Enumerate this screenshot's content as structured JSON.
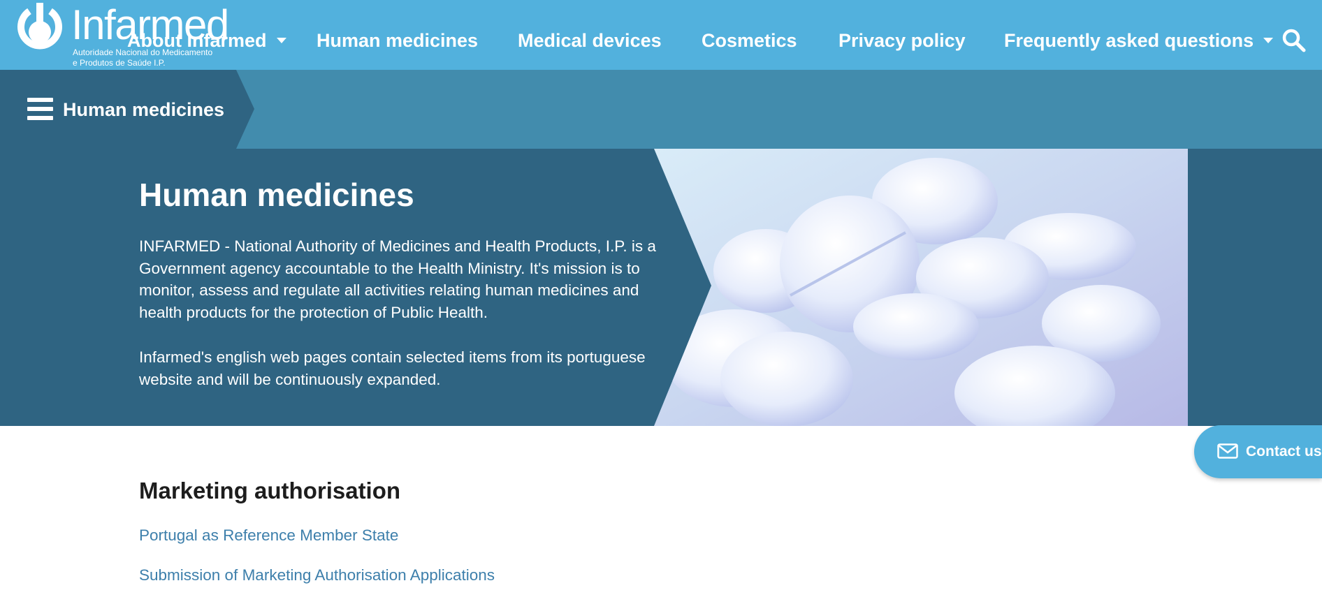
{
  "header": {
    "logo": {
      "name": "Infarmed",
      "subtitle_line1": "Autoridade Nacional do Medicamento",
      "subtitle_line2": "e Produtos de Saúde I.P."
    },
    "nav": {
      "about": "About Infarmed",
      "human_medicines": "Human medicines",
      "medical_devices": "Medical devices",
      "cosmetics": "Cosmetics",
      "privacy_policy": "Privacy policy",
      "faq": "Frequently asked questions"
    },
    "icons": [
      "caret-down-icon",
      "search-icon"
    ]
  },
  "breadcrumb": {
    "menu_icon": "hamburger-menu-icon",
    "label": "Human medicines"
  },
  "hero": {
    "title": "Human medicines",
    "paragraph1": "INFARMED - National Authority of Medicines and Health Products, I.P. is a Government agency accountable to the Health Ministry. It's mission is to monitor, assess and regulate all activities relating human medicines and health products for the protection of Public Health.",
    "paragraph2": "Infarmed's english web pages contain selected items from its portuguese website and will be continuously expanded."
  },
  "main": {
    "section_title": "Marketing authorisation",
    "links": [
      "Portugal as Reference Member State",
      "Submission of Marketing Authorisation Applications"
    ]
  },
  "contact": {
    "label": "Contact us",
    "icon": "envelope-icon"
  },
  "colors": {
    "topbar": "#52b1dd",
    "band": "#428cad",
    "hero": "#2f6482",
    "link": "#3d7fab"
  }
}
